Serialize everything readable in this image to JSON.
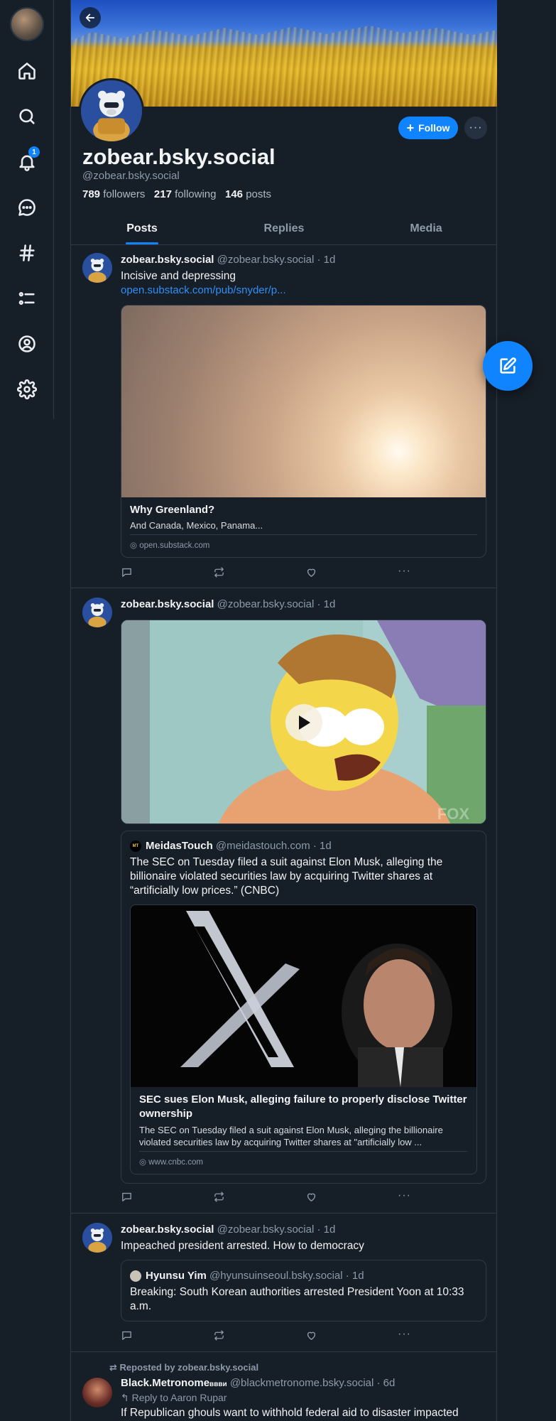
{
  "nav": {
    "notifications_badge": "1"
  },
  "profile": {
    "display_name": "zobear.bsky.social",
    "handle": "@zobear.bsky.social",
    "followers_count": "789",
    "followers_label": "followers",
    "following_count": "217",
    "following_label": "following",
    "posts_count": "146",
    "posts_label": "posts",
    "follow_label": "Follow"
  },
  "tabs": [
    {
      "label": "Posts",
      "active": true
    },
    {
      "label": "Replies",
      "active": false
    },
    {
      "label": "Media",
      "active": false
    }
  ],
  "posts": [
    {
      "author": "zobear.bsky.social",
      "handle": "@zobear.bsky.social",
      "time": "· 1d",
      "text": "Incisive and depressing",
      "link": "open.substack.com/pub/snyder/p...",
      "card": {
        "title": "Why Greenland?",
        "description": "And Canada, Mexico, Panama...",
        "domain": "open.substack.com"
      }
    },
    {
      "author": "zobear.bsky.social",
      "handle": "@zobear.bsky.social",
      "time": "· 1d",
      "quote": {
        "author": "MeidasTouch",
        "handle": "@meidastouch.com",
        "time": "· 1d",
        "text": "The SEC on Tuesday filed a suit against Elon Musk, alleging the billionaire violated securities law by acquiring Twitter shares at “artificially low prices.” (CNBC)",
        "card_title": "SEC sues Elon Musk, alleging failure to properly disclose Twitter ownership",
        "card_description": "The SEC on Tuesday filed a suit against Elon Musk, alleging the billionaire violated securities law by acquiring Twitter shares at \"artificially low ...",
        "card_domain": "www.cnbc.com"
      }
    },
    {
      "author": "zobear.bsky.social",
      "handle": "@zobear.bsky.social",
      "time": "· 1d",
      "text": "Impeached president arrested. How to democracy",
      "quote": {
        "author": "Hyunsu Yim",
        "handle": "@hyunsuinseoul.bsky.social",
        "time": "· 1d",
        "text": "Breaking: South Korean authorities arrested President Yoon at 10:33 a.m."
      }
    },
    {
      "repost_label": "Reposted by zobear.bsky.social",
      "author": "Black.Metronome",
      "author_suffix": "ввви",
      "handle": "@blackmetronome.bsky.social",
      "time": "· 6d",
      "reply_label": "Reply to Aaron Rupar",
      "text": "If Republican ghouls want to withhold federal aid to disaster impacted"
    }
  ]
}
